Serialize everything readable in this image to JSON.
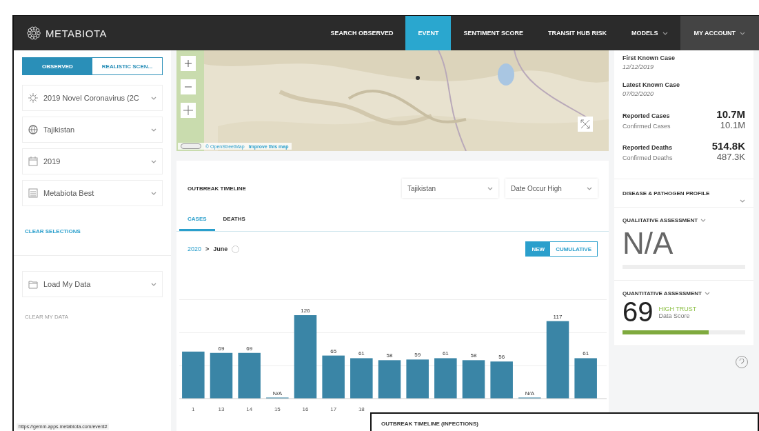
{
  "nav": {
    "logo": "METABIOTA",
    "items": [
      {
        "label": "SEARCH OBSERVED",
        "selected": false,
        "dropdown": false
      },
      {
        "label": "EVENT",
        "selected": true,
        "dropdown": false
      },
      {
        "label": "SENTIMENT SCORE",
        "selected": false,
        "dropdown": false
      },
      {
        "label": "TRANSIT HUB RISK",
        "selected": false,
        "dropdown": false
      },
      {
        "label": "MODELS",
        "selected": false,
        "dropdown": true
      },
      {
        "label": "MY ACCOUNT",
        "selected": false,
        "dropdown": true,
        "kind": "account"
      }
    ]
  },
  "sidebar": {
    "mode_tabs": [
      {
        "label": "OBSERVED",
        "selected": true
      },
      {
        "label": "REALISTIC SCEN...",
        "selected": false
      }
    ],
    "selects": [
      {
        "kind": "virus",
        "value": "2019 Novel Coronavirus (2C"
      },
      {
        "kind": "globe",
        "value": "Tajikistan"
      },
      {
        "kind": "calendar",
        "value": "2019"
      },
      {
        "kind": "list",
        "value": "Metabiota Best"
      }
    ],
    "clear_selections": "CLEAR SELECTIONS",
    "load_data": "Load My Data",
    "clear_data": {
      "label": "CLEAR MY DATA",
      "disabled": true
    },
    "status_url": "https://gemm.apps.metabiota.com/event#"
  },
  "map": {
    "attribution": [
      "© OpenStreetMap",
      "Improve this map"
    ]
  },
  "timeline": {
    "title": "OUTBREAK TIMELINE",
    "filters": [
      "Tajikistan",
      "Date Occur High"
    ],
    "tabs": [
      {
        "label": "CASES",
        "selected": true
      },
      {
        "label": "DEATHS",
        "selected": false
      }
    ],
    "breadcrumb": {
      "year": "2020",
      "separator": ">",
      "month": "June"
    },
    "toggle": [
      {
        "label": "NEW",
        "selected": true
      },
      {
        "label": "CUMULATIVE",
        "selected": false
      }
    ],
    "chart_data": {
      "type": "bar",
      "categories": [
        "1",
        "13",
        "14",
        "15",
        "16",
        "17",
        "18",
        null,
        null,
        null,
        null,
        null,
        null,
        null,
        null
      ],
      "values": [
        71,
        69,
        69,
        0,
        126,
        65,
        61,
        58,
        59,
        61,
        58,
        56,
        0,
        117,
        61
      ],
      "value_labels": [
        null,
        "69",
        "69",
        "N/A",
        "126",
        "65",
        "61",
        "58",
        "59",
        "61",
        "58",
        "56",
        "N/A",
        "117",
        "61"
      ]
    }
  },
  "summary": {
    "first_case": {
      "label": "First Known Case",
      "date": "12/12/2019"
    },
    "latest_case": {
      "label": "Latest Known Case",
      "date": "07/02/2020"
    },
    "stats": [
      {
        "label": "Reported Cases",
        "value": "10.7M",
        "sub_label": "Confirmed Cases",
        "sub_value": "10.1M"
      },
      {
        "label": "Reported Deaths",
        "value": "514.8K",
        "sub_label": "Confirmed Deaths",
        "sub_value": "487.3K"
      }
    ],
    "profile": "DISEASE & PATHOGEN PROFILE",
    "qualitative": {
      "title": "QUALITATIVE ASSESSMENT",
      "value": "N/A",
      "level": 0
    },
    "quantitative": {
      "title": "QUANTITATIVE ASSESSMENT",
      "score": "69",
      "trust": "HIGH TRUST",
      "label": "Data Score",
      "level": 0.7
    }
  },
  "overlay": {
    "title": "OUTBREAK TIMELINE (INFECTIONS)"
  }
}
